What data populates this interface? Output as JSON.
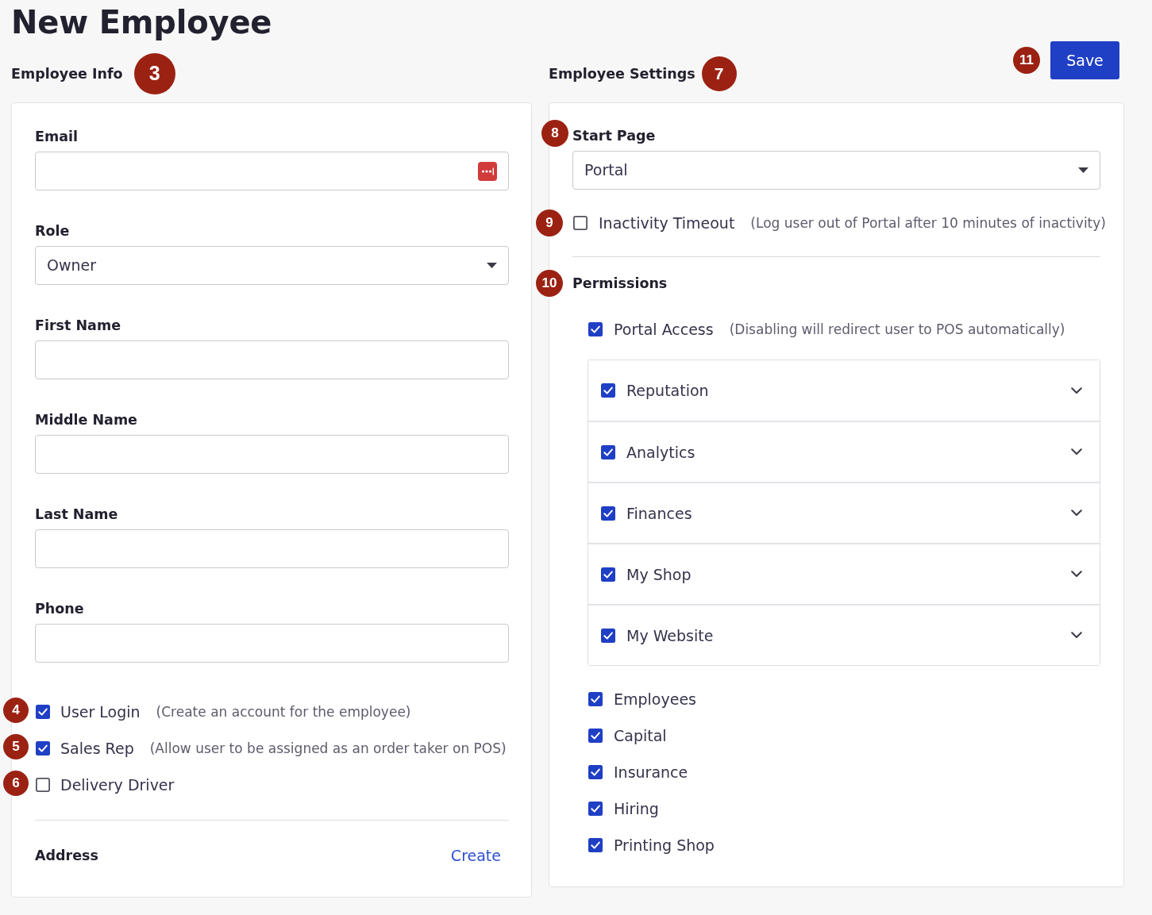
{
  "page_title": "New Employee",
  "save_button": {
    "label": "Save",
    "marker": "11"
  },
  "employee_info": {
    "heading": "Employee Info",
    "marker": "3",
    "fields": [
      {
        "kind": "email",
        "label": "Email"
      },
      {
        "kind": "select",
        "label": "Role",
        "value": "Owner"
      },
      {
        "kind": "text",
        "label": "First Name"
      },
      {
        "kind": "text",
        "label": "Middle Name"
      },
      {
        "kind": "text",
        "label": "Last Name"
      },
      {
        "kind": "text",
        "label": "Phone"
      }
    ],
    "options": [
      {
        "label": "User Login",
        "hint": "(Create an account for the employee)",
        "checked": true,
        "marker": "4"
      },
      {
        "label": "Sales Rep",
        "hint": "(Allow user to be assigned as an order taker on POS)",
        "checked": true,
        "marker": "5"
      },
      {
        "label": "Delivery Driver",
        "checked": false,
        "marker": "6"
      }
    ],
    "address": {
      "label": "Address",
      "link": "Create"
    }
  },
  "employee_settings": {
    "heading": "Employee Settings",
    "marker": "7",
    "start_page": {
      "label": "Start Page",
      "value": "Portal",
      "marker": "8"
    },
    "inactivity_timeout": {
      "label": "Inactivity Timeout",
      "hint": "(Log user out of Portal after 10 minutes of inactivity)",
      "checked": false,
      "marker": "9"
    },
    "permissions": {
      "heading": "Permissions",
      "marker": "10",
      "portal_access": {
        "label": "Portal Access",
        "hint": "(Disabling will redirect user to POS automatically)",
        "checked": true
      },
      "groups": [
        {
          "label": "Reputation",
          "checked": true,
          "expanded": false
        },
        {
          "label": "Analytics",
          "checked": true,
          "expanded": false
        },
        {
          "label": "Finances",
          "checked": true,
          "expanded": false
        },
        {
          "label": "My Shop",
          "checked": true,
          "expanded": false
        },
        {
          "label": "My Website",
          "checked": true,
          "expanded": false
        }
      ],
      "items": [
        {
          "label": "Employees",
          "checked": true
        },
        {
          "label": "Capital",
          "checked": true
        },
        {
          "label": "Insurance",
          "checked": true
        },
        {
          "label": "Hiring",
          "checked": true
        },
        {
          "label": "Printing Shop",
          "checked": true
        }
      ]
    }
  }
}
